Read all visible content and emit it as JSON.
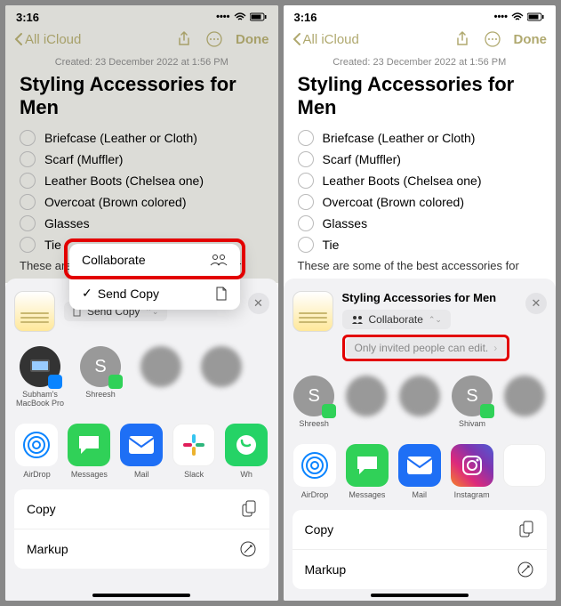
{
  "status": {
    "time": "3:16",
    "icons": "􀙇 􀛨"
  },
  "nav": {
    "back": "All iCloud",
    "done": "Done"
  },
  "note": {
    "created": "Created: 23 December 2022 at 1:56 PM",
    "title": "Styling Accessories for Men",
    "items": [
      "Briefcase (Leather or Cloth)",
      "Scarf (Muffler)",
      "Leather Boots (Chelsea one)",
      "Overcoat (Brown colored)",
      "Glasses",
      "Tie"
    ],
    "body": "These are some of the best accessories for"
  },
  "popover": {
    "collaborate": "Collaborate",
    "sendCopy": "Send Copy"
  },
  "sheet": {
    "sendCopyPill": "Send Copy",
    "title": "Styling Accessories for Men",
    "collaboratePill": "Collaborate",
    "permissionPill": "Only invited people can edit.",
    "contactsA": [
      {
        "name": "Subham's MacBook Pro",
        "initial": "",
        "type": "mac"
      },
      {
        "name": "Shreesh",
        "initial": "S",
        "badge": "green"
      },
      {
        "name": "",
        "initial": "",
        "blur": true
      },
      {
        "name": "",
        "initial": "",
        "blur": true
      }
    ],
    "contactsB": [
      {
        "name": "Shreesh",
        "initial": "S",
        "badge": "green"
      },
      {
        "name": "",
        "initial": "",
        "blur": true
      },
      {
        "name": "",
        "initial": "",
        "blur": true
      },
      {
        "name": "Shivam",
        "initial": "S",
        "badge": "green"
      },
      {
        "name": "",
        "initial": "",
        "blur": true
      }
    ],
    "appsA": [
      {
        "name": "AirDrop",
        "cls": "airdrop"
      },
      {
        "name": "Messages",
        "cls": "messages"
      },
      {
        "name": "Mail",
        "cls": "mail"
      },
      {
        "name": "Slack",
        "cls": "slack"
      },
      {
        "name": "Wh",
        "cls": "whatsapp"
      }
    ],
    "appsB": [
      {
        "name": "AirDrop",
        "cls": "airdrop"
      },
      {
        "name": "Messages",
        "cls": "messages"
      },
      {
        "name": "Mail",
        "cls": "mail"
      },
      {
        "name": "Instagram",
        "cls": "instagram"
      }
    ],
    "actions": {
      "copy": "Copy",
      "markup": "Markup"
    }
  }
}
